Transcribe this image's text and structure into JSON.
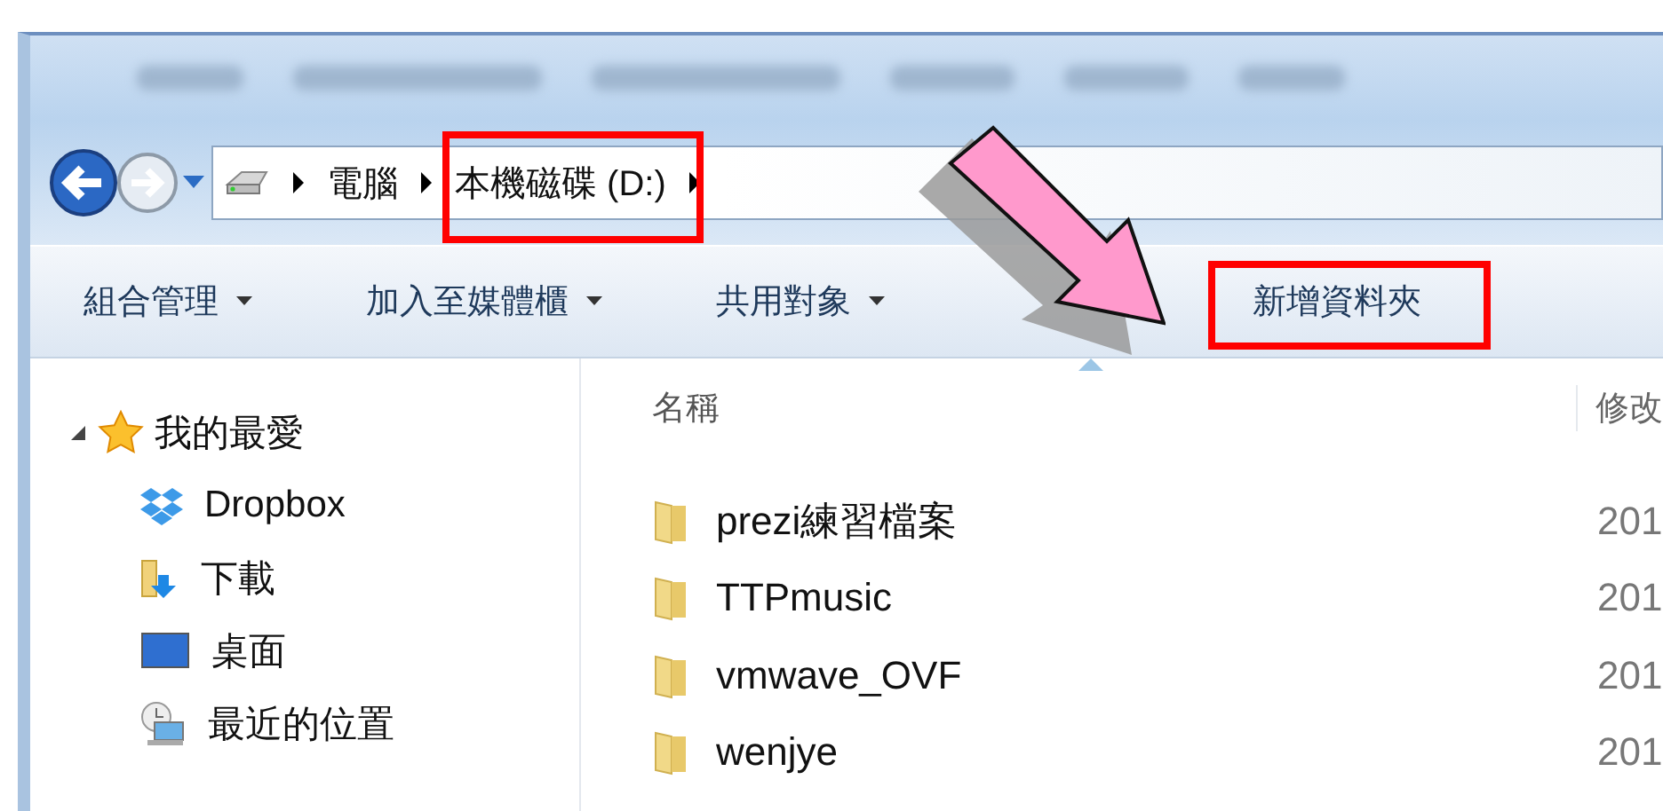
{
  "address_bar": {
    "crumbs": [
      {
        "label": "電腦",
        "highlighted": false
      },
      {
        "label": "本機磁碟 (D:)",
        "highlighted": true
      }
    ]
  },
  "toolbar": {
    "buttons": [
      {
        "label": "組合管理",
        "dropdown": true,
        "highlighted": false
      },
      {
        "label": "加入至媒體櫃",
        "dropdown": true,
        "highlighted": false
      },
      {
        "label": "共用對象",
        "dropdown": true,
        "highlighted": false
      },
      {
        "label": "新增資料夾",
        "dropdown": false,
        "highlighted": true
      }
    ]
  },
  "navigation": {
    "items": [
      {
        "label": "我的最愛",
        "kind": "favorites",
        "expanded": true,
        "children": [
          {
            "label": "Dropbox",
            "kind": "dropbox"
          },
          {
            "label": "下載",
            "kind": "downloads"
          },
          {
            "label": "桌面",
            "kind": "desktop"
          },
          {
            "label": "最近的位置",
            "kind": "recent"
          }
        ]
      }
    ]
  },
  "file_list": {
    "columns": [
      "名稱",
      "修改"
    ],
    "rows": [
      {
        "name": "prezi練習檔案",
        "date": "201"
      },
      {
        "name": "TTPmusic",
        "date": "201"
      },
      {
        "name": "vmwave_OVF",
        "date": "201"
      },
      {
        "name": "wenjye",
        "date": "201"
      }
    ]
  }
}
